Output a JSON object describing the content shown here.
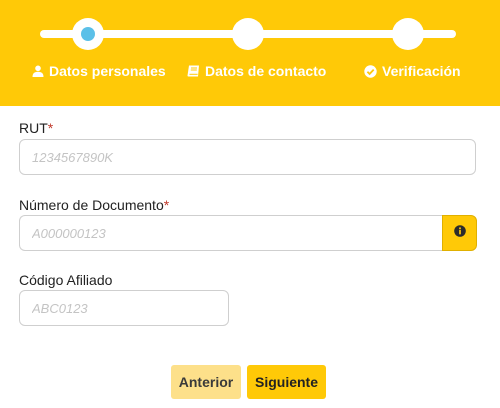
{
  "stepper": {
    "steps": [
      {
        "label": "Datos personales",
        "icon": "user-icon",
        "active": true
      },
      {
        "label": "Datos de contacto",
        "icon": "book-icon",
        "active": false
      },
      {
        "label": "Verificación",
        "icon": "check-circle-icon",
        "active": false
      }
    ]
  },
  "form": {
    "rut": {
      "label": "RUT",
      "required_mark": "*",
      "placeholder": "1234567890K",
      "value": ""
    },
    "documento": {
      "label": "Número de Documento",
      "required_mark": "*",
      "placeholder": "A000000123",
      "value": "",
      "info_icon": "info-icon"
    },
    "afiliado": {
      "label": "Código Afiliado",
      "placeholder": "ABC0123",
      "value": ""
    }
  },
  "buttons": {
    "previous": "Anterior",
    "next": "Siguiente"
  },
  "colors": {
    "brand_yellow": "#ffc907",
    "active_dot": "#5bc0e8",
    "disabled_yellow": "#fde08a",
    "required": "#c0392b"
  }
}
